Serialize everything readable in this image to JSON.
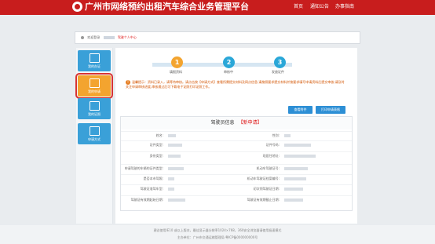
{
  "header": {
    "title": "广州市网络预约出租汽车综合业务管理平台",
    "nav": [
      "首页",
      "通知公告",
      "办事指南"
    ]
  },
  "breadcrumb": {
    "welcome": "欢迎登录",
    "role": "驾驶个人中心"
  },
  "sidebar": {
    "items": [
      {
        "label": "我的办证"
      },
      {
        "label": "我的申请"
      },
      {
        "label": "我的证照"
      },
      {
        "label": "申请方式"
      }
    ]
  },
  "steps": [
    {
      "num": "1",
      "label": "填报资料"
    },
    {
      "num": "2",
      "label": "审核中"
    },
    {
      "num": "3",
      "label": "发放证件"
    }
  ],
  "notice": {
    "text": "温馨提示：资料已录入，请等待审核。请点击按【申请方式】查看所需提交材料及网点信息,请按照要求提交材料并按要求填写申请资料后提交审核;请及时关注申请审核进度,审核通过后可下载电子证照打印证照工作。"
  },
  "buttons": {
    "view_attachment": "查看附件",
    "print_form": "打印申请表格"
  },
  "table": {
    "title": "驾驶员信息",
    "status": "【新申请】",
    "rows": [
      [
        "姓名:",
        "性别:"
      ],
      [
        "证件类型:",
        "证件号码:"
      ],
      [
        "身份类型:",
        "现居住地址:"
      ],
      [
        "申请驾驶的车辆的证件类型:",
        "机动车驾驶证号:"
      ],
      [
        "是否本市驾照:",
        "机动车驾驶证档案编号:"
      ],
      [
        "驾驶证准驾车型:",
        "初次领驾驶证日期:"
      ],
      [
        "驾驶证有效期起始日期:",
        "驾驶证有效期截止日期:"
      ]
    ]
  },
  "footer": {
    "line1": "建议使用IE10 或以上版本，最佳显示器分辨率1024×768，360安全浏览器请使用极速模式",
    "line2": "主办单位：广州市交通运输管理局  粤ICP备000000000号"
  },
  "colors": {
    "brand": "#c81d1d",
    "accent": "#3aa0d8",
    "step": "#f3a42f",
    "step_done": "#2aa7d8"
  }
}
